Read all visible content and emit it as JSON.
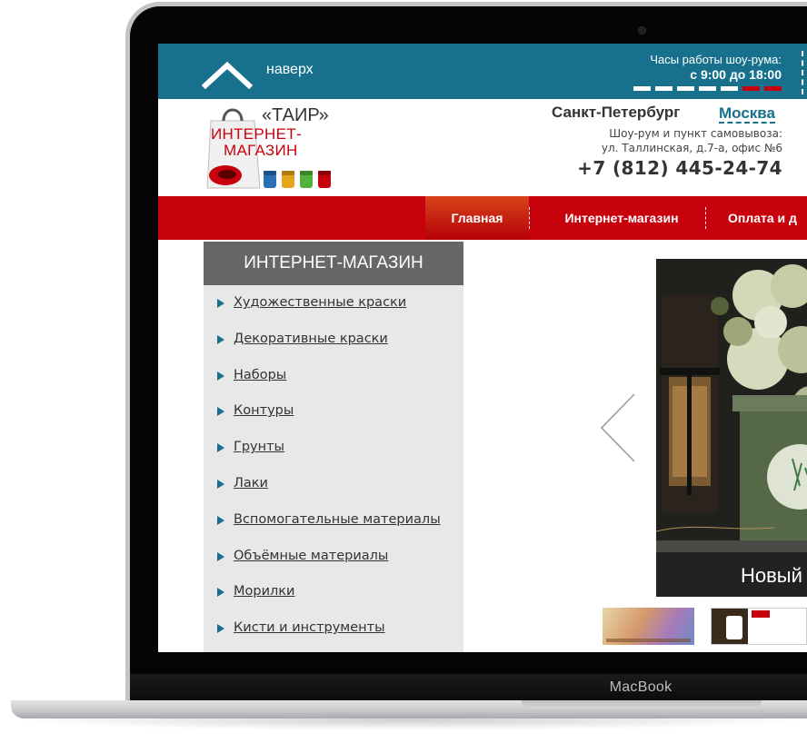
{
  "device": {
    "brand": "MacBook"
  },
  "topbar": {
    "back_to_top_label": "наверх",
    "hours_title": "Часы работы шоу-рума:",
    "hours_time": "с 9:00 до 18:00",
    "week_days_open": 5,
    "week_days_closed": 2
  },
  "header": {
    "logo_quote": "«ТАИР»",
    "logo_line1": "ИНТЕРНЕТ-",
    "logo_line2": "МАГАЗИН",
    "city_current": "Санкт-Петербург",
    "city_alt": "Москва",
    "address_line1": "Шоу-рум и пункт самовывоза:",
    "address_line2": "ул. Таллинская, д.7-а, офис №6",
    "phone": "+7 (812) 445-24-74"
  },
  "nav": {
    "items": [
      {
        "label": "Главная",
        "active": true
      },
      {
        "label": "Интернет-магазин",
        "active": false
      },
      {
        "label": "Оплата и д",
        "active": false
      }
    ]
  },
  "sidebar": {
    "title": "ИНТЕРНЕТ-МАГАЗИН",
    "items": [
      {
        "label": "Художественные краски"
      },
      {
        "label": "Декоративные краски"
      },
      {
        "label": "Наборы"
      },
      {
        "label": "Контуры"
      },
      {
        "label": "Грунты"
      },
      {
        "label": "Лаки"
      },
      {
        "label": "Вспомогательные материалы"
      },
      {
        "label": "Объёмные материалы"
      },
      {
        "label": "Морилки"
      },
      {
        "label": "Кисти и инструменты"
      }
    ]
  },
  "slider": {
    "caption": "Новый"
  },
  "colors": {
    "topbar": "#17718c",
    "nav": "#c8020c",
    "sidebar_title": "#676767",
    "sidebar_bg": "#e8e8e8"
  }
}
